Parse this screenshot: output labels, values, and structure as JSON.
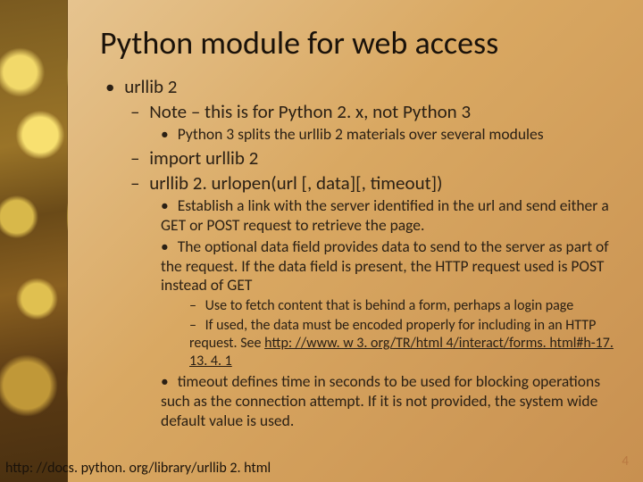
{
  "title": "Python module for web access",
  "bullets": {
    "b1": "urllib 2",
    "b2": "Note – this is for Python 2. x, not Python 3",
    "b3": "Python 3 splits the urllib 2 materials over several modules",
    "b4": "import urllib 2",
    "b5": "urllib 2. urlopen(url [, data][, timeout])",
    "b6": "Establish a link with the server identified in the url and send either a GET or POST request to retrieve the page.",
    "b7": "The optional data field provides data to send to the server as part of the request.  If the data field is present, the HTTP request used is POST instead of GET",
    "b8": "Use to fetch content that is behind a form, perhaps a login page",
    "b9a": "If used, the data must be encoded properly for including in an HTTP request.  See ",
    "b9_link": "http: //www. w 3. org/TR/html 4/interact/forms. html#h-17. 13. 4. 1",
    "b10": "timeout defines time in seconds to be used for blocking operations such as the connection attempt.  If it is not provided, the system wide default value is used."
  },
  "footer_url": "http: //docs. python. org/library/urllib 2. html",
  "page_number": "4"
}
